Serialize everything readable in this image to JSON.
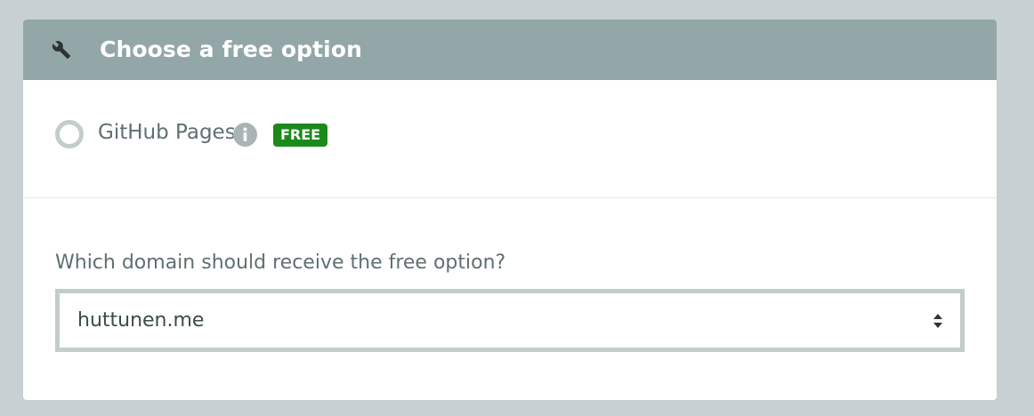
{
  "header": {
    "icon": "wrench-icon",
    "title": "Choose a free option"
  },
  "option": {
    "label": "GitHub Pages",
    "info_icon": "info-icon",
    "badge": "FREE",
    "selected": false
  },
  "domain_select": {
    "question": "Which domain should receive the free option?",
    "value": "huttunen.me",
    "arrow_icon": "sort-arrows-icon"
  },
  "colors": {
    "page_background": "#c7d0d2",
    "header_background": "#94a7a8",
    "badge_background": "#1b8a1b",
    "text": "#5f7071",
    "border": "#c4cccd"
  }
}
